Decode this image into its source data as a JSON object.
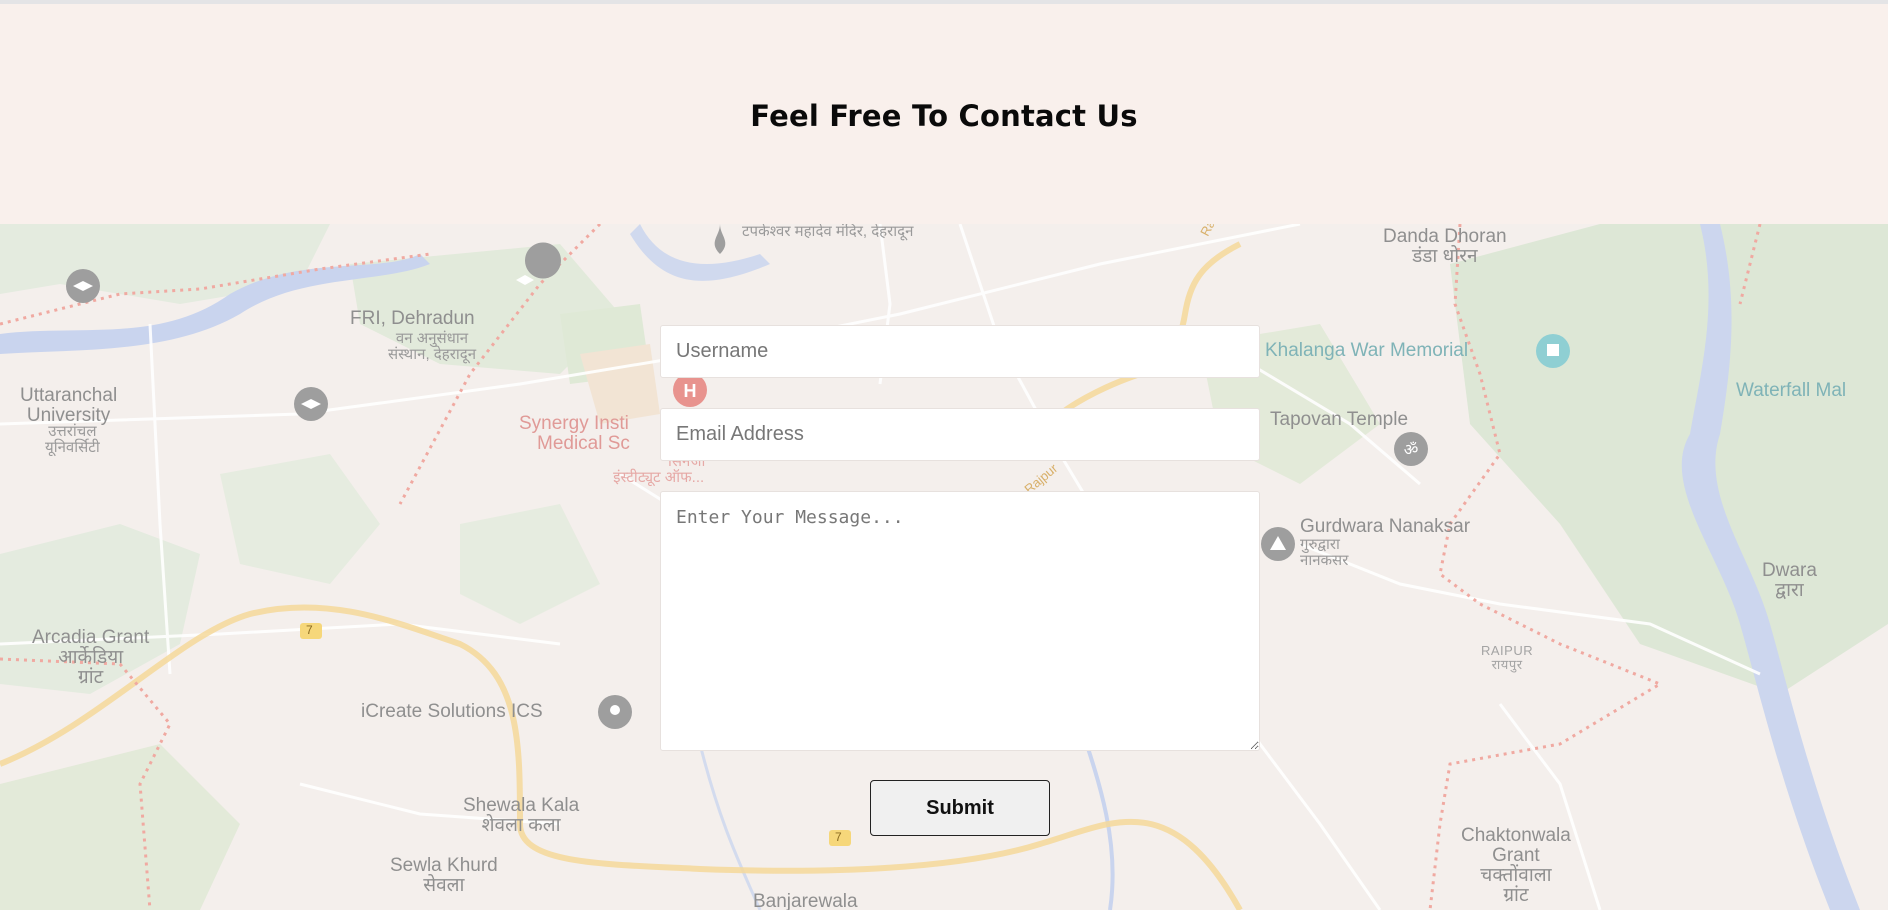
{
  "header": {
    "title": "Feel Free To Contact Us"
  },
  "form": {
    "username_placeholder": "Username",
    "email_placeholder": "Email Address",
    "message_placeholder": "Enter Your Message...",
    "submit_label": "Submit"
  },
  "map": {
    "labels": {
      "tapkeshwar": "टपकेश्वर महादेव मंदिर, देहरादून",
      "danda_dhoran": "Danda Dhoran",
      "danda_dhoran_hi": "डंडा धोरन",
      "fri": "FRI, Dehradun",
      "fri_hi_1": "वन अनुसंधान",
      "fri_hi_2": "संस्थान, देहरादून",
      "uttaranchal_1": "Uttaranchal",
      "uttaranchal_2": "University",
      "uttaranchal_hi_1": "उत्तरांचल",
      "uttaranchal_hi_2": "यूनिवर्सिटी",
      "synergy_1": "Synergy Insti",
      "synergy_2": "Medical Sc",
      "synergy_hi_1": "सिनर्जी",
      "synergy_hi_2": "इंस्टीट्यूट ऑफ...",
      "khalanga": "Khalanga War Memorial",
      "tapovan": "Tapovan Temple",
      "gurdwara_1": "Gurdwara Nanaksar",
      "gurdwara_hi_1": "गुरुद्वारा",
      "gurdwara_hi_2": "नानकसर",
      "waterfall": "Waterfall Mal",
      "dwara": "Dwara",
      "dwara_hi": "द्वारा",
      "raipur": "RAIPUR",
      "raipur_hi": "रायपुर",
      "arcadia_1": "Arcadia Grant",
      "arcadia_hi_1": "आर्केडिया",
      "arcadia_hi_2": "ग्रांट",
      "icreate": "iCreate Solutions ICS",
      "shewala": "Shewala Kala",
      "shewala_hi": "शेवला कला",
      "sewla": "Sewla Khurd",
      "sewla_hi": "सेवला",
      "banjarewala": "Banjarewala",
      "chaktonwala_1": "Chaktonwala",
      "chaktonwala_2": "Grant",
      "chaktonwala_hi_1": "चक्तोंवाला",
      "chaktonwala_hi_2": "ग्रांट",
      "route_7a": "7",
      "route_7b": "7",
      "rajpur": "Rajpur",
      "rajpur2": "Rajpur"
    }
  },
  "colors": {
    "header_bg": "#f9f0ec",
    "map_bg": "#f4efec",
    "water": "#c9d4ee",
    "park": "#dfe9d8",
    "road_major": "#f6dca0",
    "boundary": "#f0a9a1"
  },
  "icons": [
    "graduation-cap-icon",
    "temple-icon",
    "hospital-icon",
    "monument-icon",
    "om-icon",
    "gurdwara-icon",
    "location-pin-icon"
  ]
}
